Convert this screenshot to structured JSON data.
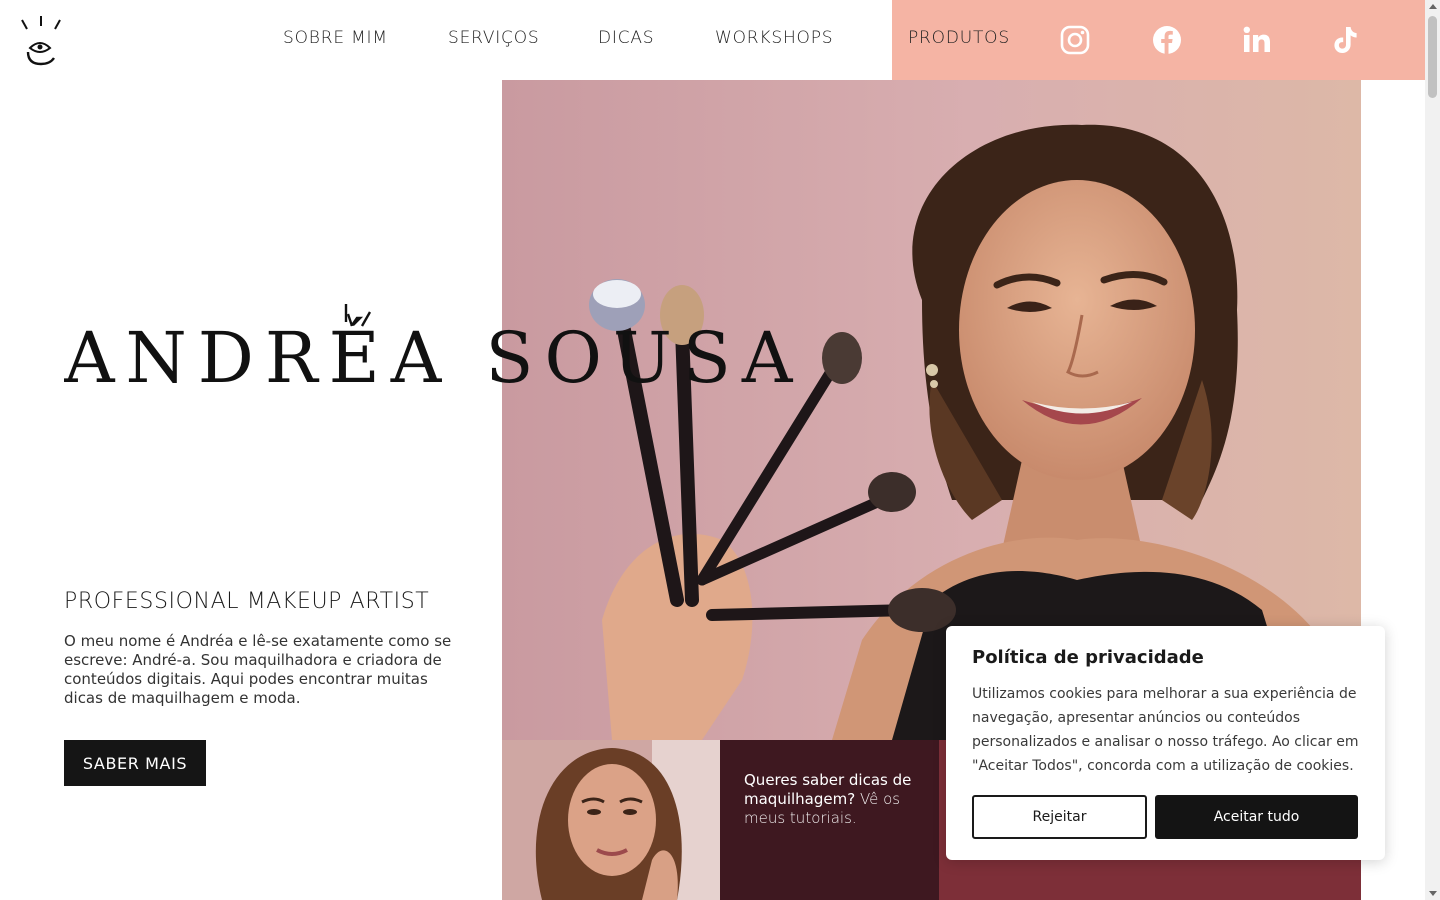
{
  "header": {
    "logo_name": "andrea-sousa-logo",
    "nav": [
      {
        "label": "SOBRE MIM"
      },
      {
        "label": "SERVIÇOS"
      },
      {
        "label": "DICAS"
      },
      {
        "label": "WORKSHOPS"
      },
      {
        "label": "PRODUTOS"
      }
    ],
    "social": [
      "instagram-icon",
      "facebook-icon",
      "linkedin-icon",
      "tiktok-icon"
    ],
    "accent_color": "#f5b4a4"
  },
  "hero": {
    "brand_name": "ANDRÉA SOUSA",
    "subtitle": "PROFESSIONAL MAKEUP ARTIST",
    "intro": "O meu nome é Andréa e lê-se exatamente como se escreve: André-a. Sou maquilhadora e criadora de conteúdos digitais. Aqui podes encontrar muitas dicas de maquilhagem e moda.",
    "cta_label": "SABER MAIS"
  },
  "tiles": {
    "tutorial_bold": "Queres saber dicas de maquilhagem?",
    "tutorial_light": "Vê os meus tutoriais.",
    "dark_color": "#3e1820",
    "red_color": "#7d2f38"
  },
  "cookie": {
    "title": "Política de privacidade",
    "body": "Utilizamos cookies para melhorar a sua experiência de navegação, apresentar anúncios ou conteúdos personalizados e analisar o nosso tráfego. Ao clicar em \"Aceitar Todos\", concorda com a utilização de cookies.",
    "reject_label": "Rejeitar",
    "accept_label": "Aceitar tudo"
  }
}
